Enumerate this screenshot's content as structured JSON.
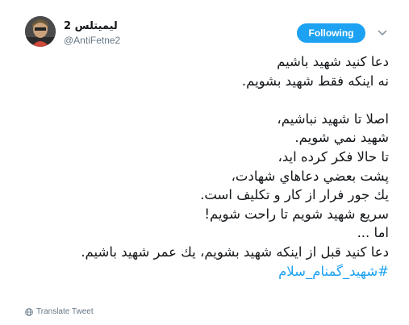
{
  "user": {
    "display_name": "ليميتلس 2",
    "handle": "@AntiFetne2"
  },
  "follow_button": {
    "label": "Following"
  },
  "tweet": {
    "lines": [
      "دعا كنيد شهيد باشيم",
      "نه اينكه فقط شهيد بشويم.",
      "",
      "اصلا تا شهيد نباشيم،",
      "شهيد نمي شويم.",
      "تا حالا فكر كرده ايد،",
      "پشت بعضي دعاهاي شهادت،",
      "يك جور فرار از كار و تكليف است.",
      "سريع شهيد شويم تا راحت شويم!",
      "اما ...",
      "دعا كنيد قبل از اينكه شهيد بشويم، يك عمر شهيد باشيم."
    ],
    "hashtag": "#شهید_گمنام_سلام"
  },
  "translate": {
    "label": "Translate Tweet"
  },
  "colors": {
    "accent": "#1da1f2",
    "secondary_text": "#657786"
  },
  "icons": {
    "caret": "chevron-down-icon",
    "translate": "globe-icon"
  }
}
